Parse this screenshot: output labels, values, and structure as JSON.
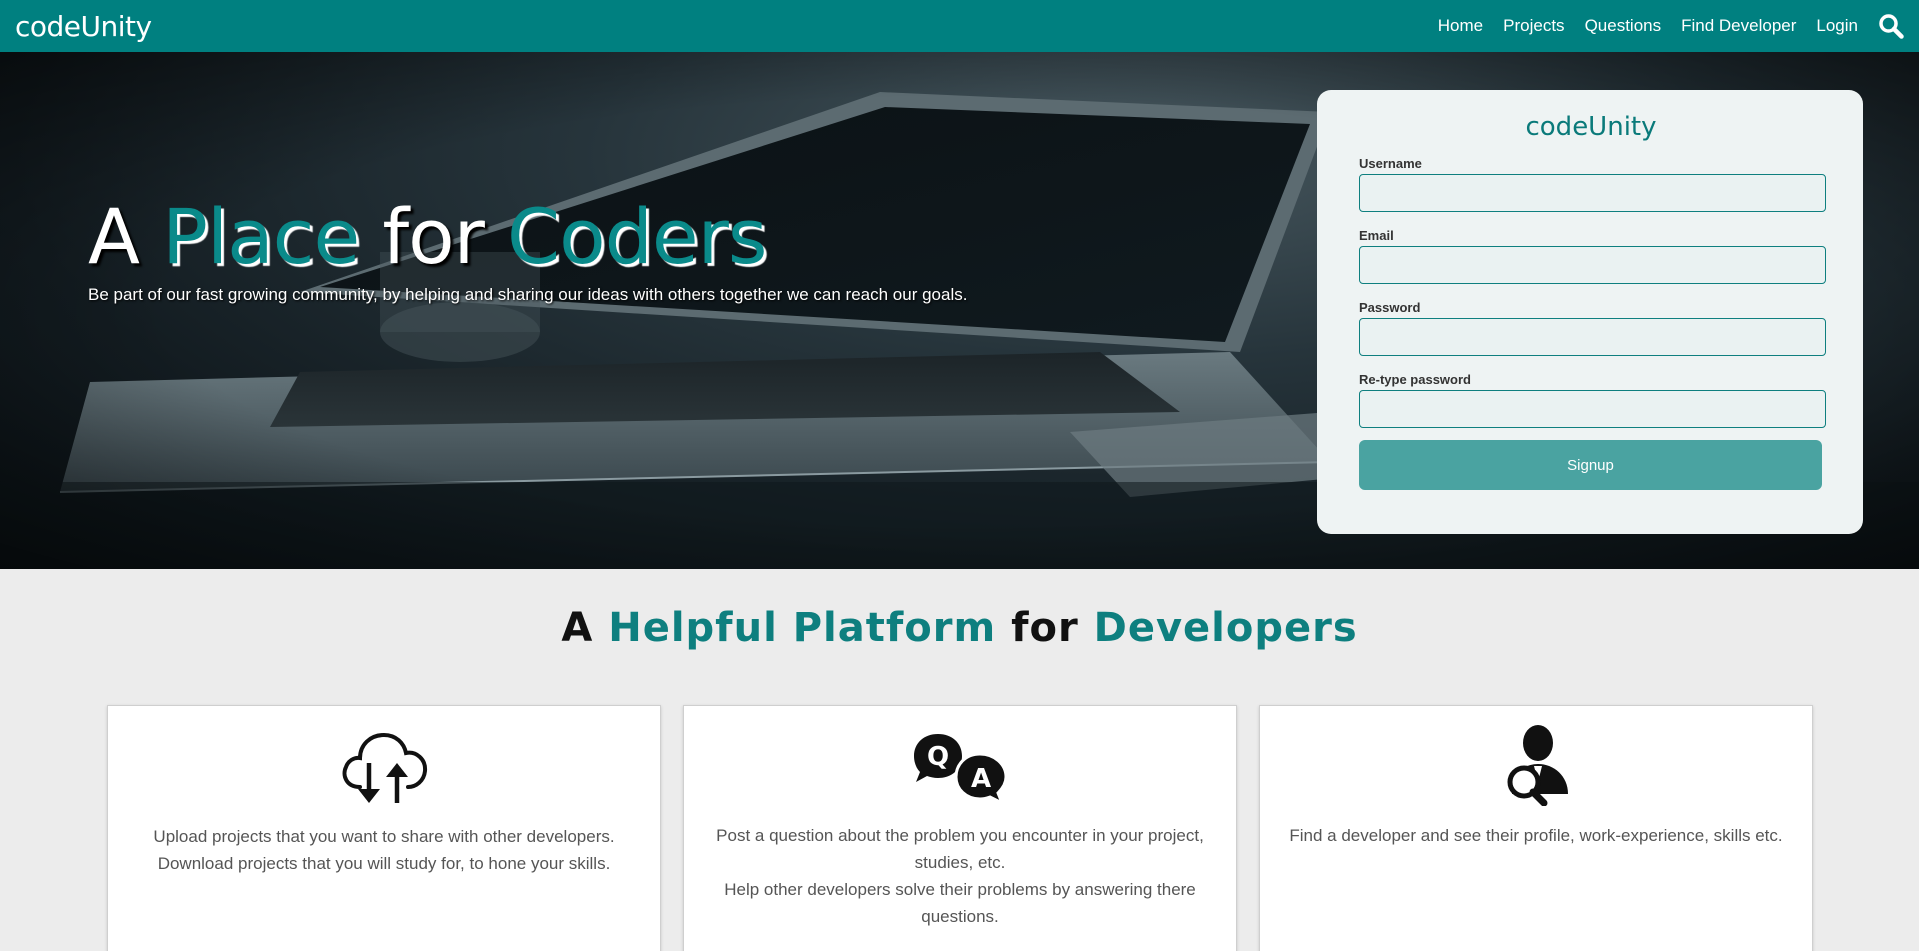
{
  "navbar": {
    "brand": "codeUnity",
    "links": [
      "Home",
      "Projects",
      "Questions",
      "Find Developer",
      "Login"
    ],
    "search_icon": "search-icon"
  },
  "hero": {
    "title_part1": "A ",
    "title_accent1": "Place",
    "title_part2": " for ",
    "title_accent2": "Coders",
    "subtitle": "Be part of our fast growing community, by helping and sharing our ideas with others together we can reach our goals."
  },
  "signup": {
    "brand": "codeUnity",
    "username_label": "Username",
    "email_label": "Email",
    "password_label": "Password",
    "retype_label": "Re-type password",
    "button": "Signup"
  },
  "section": {
    "title_part1": "A ",
    "title_accent1": "Helpful Platform",
    "title_part2": " for ",
    "title_accent2": "Developers"
  },
  "features": [
    {
      "icon": "cloud-upload-download-icon",
      "line1": "Upload projects that you want to share with other developers.",
      "line2": "Download projects that you will study for, to hone your skills."
    },
    {
      "icon": "question-answer-icon",
      "line1": "Post a question about the problem you encounter in your project, studies, etc.",
      "line2": "Help other developers solve their problems by answering there questions."
    },
    {
      "icon": "find-developer-icon",
      "line1": "Find a developer and see their profile, work-experience, skills etc."
    }
  ],
  "colors": {
    "primary": "#008080",
    "accent": "#0e7f7f",
    "button": "#4aa3a1",
    "background": "#ececec"
  }
}
